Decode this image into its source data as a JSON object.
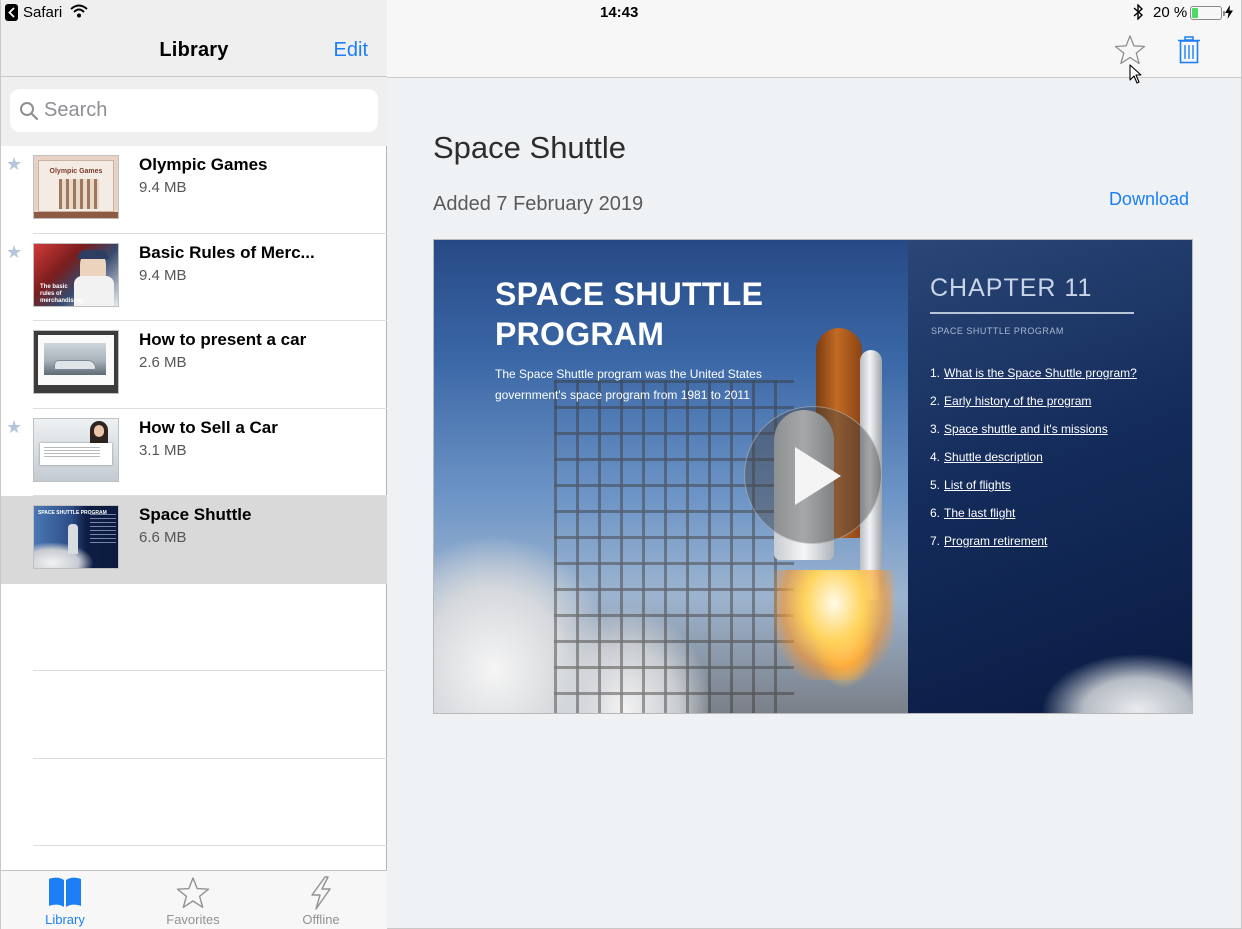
{
  "status_bar": {
    "back_app": "Safari",
    "time": "14:43",
    "battery_percent": "20 %",
    "battery_level": 0.2
  },
  "sidebar": {
    "title": "Library",
    "edit_label": "Edit",
    "search_placeholder": "Search",
    "items": [
      {
        "name": "Olympic Games",
        "size": "9.4 MB",
        "favorite": true,
        "selected": false,
        "thumbnail_title": "Olympic Games"
      },
      {
        "name": "Basic Rules of Merc...",
        "size": "9.4 MB",
        "favorite": true,
        "selected": false,
        "thumbnail_title": "The basic rules of merchandising"
      },
      {
        "name": "How to present a car",
        "size": "2.6 MB",
        "favorite": false,
        "selected": false
      },
      {
        "name": "How to Sell a Car",
        "size": "3.1 MB",
        "favorite": true,
        "selected": false
      },
      {
        "name": "Space Shuttle",
        "size": "6.6 MB",
        "favorite": false,
        "selected": true,
        "thumbnail_title": "SPACE SHUTTLE PROGRAM"
      }
    ]
  },
  "tabbar": {
    "tabs": [
      {
        "label": "Library",
        "icon": "book-icon",
        "active": true
      },
      {
        "label": "Favorites",
        "icon": "star-icon",
        "active": false
      },
      {
        "label": "Offline",
        "icon": "lightning-icon",
        "active": false
      }
    ]
  },
  "detail": {
    "title": "Space Shuttle",
    "added": "Added 7 February 2019",
    "download_label": "Download",
    "preview": {
      "heading_line1": "SPACE SHUTTLE",
      "heading_line2": "PROGRAM",
      "subtitle": "The Space Shuttle program was the United States government's space program from 1981 to 2011",
      "chapter": "CHAPTER 11",
      "chapter_subtitle": "SPACE SHUTTLE PROGRAM",
      "toc": [
        {
          "num": "1.",
          "text": "What is the Space Shuttle program?"
        },
        {
          "num": "2.",
          "text": "Early history of the program"
        },
        {
          "num": "3.",
          "text": "Space shuttle and it's missions"
        },
        {
          "num": "4.",
          "text": "Shuttle description"
        },
        {
          "num": "5.",
          "text": "List of flights"
        },
        {
          "num": "6.",
          "text": "The last flight"
        },
        {
          "num": "7.",
          "text": "Program retirement"
        }
      ]
    }
  },
  "colors": {
    "accent": "#1d7ff5",
    "selected_row": "#d9d9d9",
    "favorite_star": "#b4c4db",
    "detail_background": "#eff2f5"
  }
}
